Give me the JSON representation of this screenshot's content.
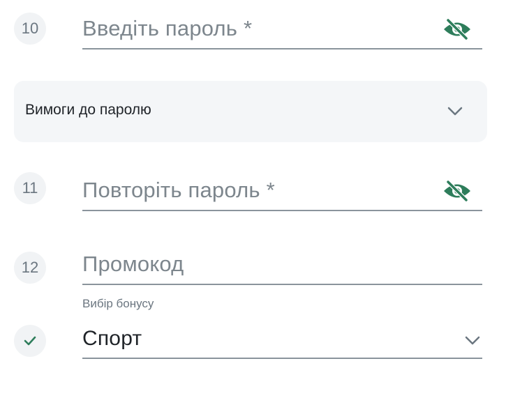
{
  "password": {
    "step": "10",
    "placeholder": "Введіть пароль *",
    "icon": "eye-off-icon"
  },
  "requirements": {
    "label": "Вимоги до паролю",
    "icon": "chevron-down-icon"
  },
  "repeat_password": {
    "step": "11",
    "placeholder": "Повторіть пароль *",
    "icon": "eye-off-icon"
  },
  "promo": {
    "step": "12",
    "placeholder": "Промокод"
  },
  "bonus": {
    "caption": "Вибір бонусу",
    "value": "Спорт",
    "status_icon": "check-icon",
    "icon": "chevron-down-icon"
  },
  "colors": {
    "accent_green": "#2e7d5b",
    "text_muted": "#7d868d",
    "underline": "#8a949c"
  }
}
